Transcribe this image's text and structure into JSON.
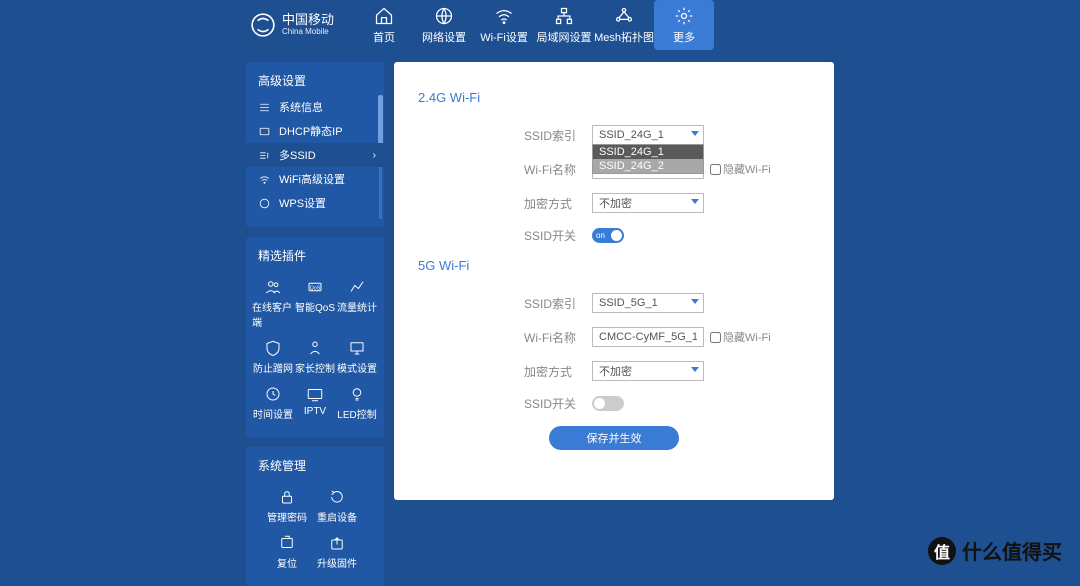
{
  "brand": {
    "cn": "中国移动",
    "en": "China Mobile"
  },
  "nav": [
    {
      "label": "首页"
    },
    {
      "label": "网络设置"
    },
    {
      "label": "Wi-Fi设置"
    },
    {
      "label": "局域网设置"
    },
    {
      "label": "Mesh拓扑图"
    },
    {
      "label": "更多"
    }
  ],
  "sidebar": {
    "advanced": {
      "title": "高级设置",
      "items": [
        {
          "label": "系统信息"
        },
        {
          "label": "DHCP静态IP"
        },
        {
          "label": "多SSID"
        },
        {
          "label": "WiFi高级设置"
        },
        {
          "label": "WPS设置"
        }
      ]
    },
    "plugins": {
      "title": "精选插件",
      "items": [
        {
          "label": "在线客户端"
        },
        {
          "label": "智能QoS"
        },
        {
          "label": "流量统计"
        },
        {
          "label": "防止蹭网"
        },
        {
          "label": "家长控制"
        },
        {
          "label": "模式设置"
        },
        {
          "label": "时间设置"
        },
        {
          "label": "IPTV"
        },
        {
          "label": "LED控制"
        }
      ]
    },
    "system": {
      "title": "系统管理",
      "items": [
        {
          "label": "管理密码"
        },
        {
          "label": "重启设备"
        },
        {
          "label": "复位"
        },
        {
          "label": "升级固件"
        }
      ]
    }
  },
  "form": {
    "section24": "2.4G Wi-Fi",
    "section5": "5G Wi-Fi",
    "labels": {
      "ssid_index": "SSID索引",
      "wifi_name": "Wi-Fi名称",
      "encryption": "加密方式",
      "ssid_switch": "SSID开关",
      "hide_wifi": "隐藏Wi-Fi"
    },
    "values": {
      "ssid24_index": "SSID_24G_1",
      "ssid24_options": [
        "SSID_24G_1",
        "SSID_24G_2"
      ],
      "enc24": "不加密",
      "toggle_on": "on",
      "ssid5_index": "SSID_5G_1",
      "wifi5_name": "CMCC-CyMF_5G_1",
      "enc5": "不加密"
    },
    "save": "保存并生效"
  },
  "watermark": {
    "badge": "值",
    "text": "什么值得买"
  }
}
